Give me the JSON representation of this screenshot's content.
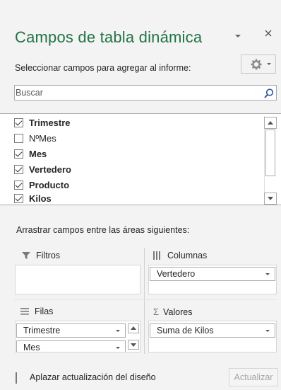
{
  "panel": {
    "title": "Campos de tabla dinámica",
    "subtitle": "Seleccionar campos para agregar al informe:",
    "search_placeholder": "Buscar",
    "fields": [
      {
        "label": "Trimestre",
        "checked": true
      },
      {
        "label": "NºMes",
        "checked": false
      },
      {
        "label": "Mes",
        "checked": true
      },
      {
        "label": "Vertedero",
        "checked": true
      },
      {
        "label": "Producto",
        "checked": true
      },
      {
        "label": "Kilos",
        "checked": true
      }
    ],
    "drag_instruction": "Arrastrar campos entre las áreas siguientes:",
    "areas": {
      "filters": {
        "label": "Filtros",
        "icon": "filter-icon",
        "items": []
      },
      "columns": {
        "label": "Columnas",
        "icon": "columns-icon",
        "items": [
          "Vertedero"
        ]
      },
      "rows": {
        "label": "Filas",
        "icon": "rows-icon",
        "items": [
          "Trimestre",
          "Mes"
        ]
      },
      "values": {
        "label": "Valores",
        "icon": "sigma-icon",
        "items": [
          "Suma de Kilos"
        ]
      }
    },
    "defer_label": "Aplazar actualización del diseño",
    "update_label": "Actualizar"
  },
  "colors": {
    "accent": "#217346",
    "background": "#f3f3f3",
    "border": "#ababab"
  }
}
